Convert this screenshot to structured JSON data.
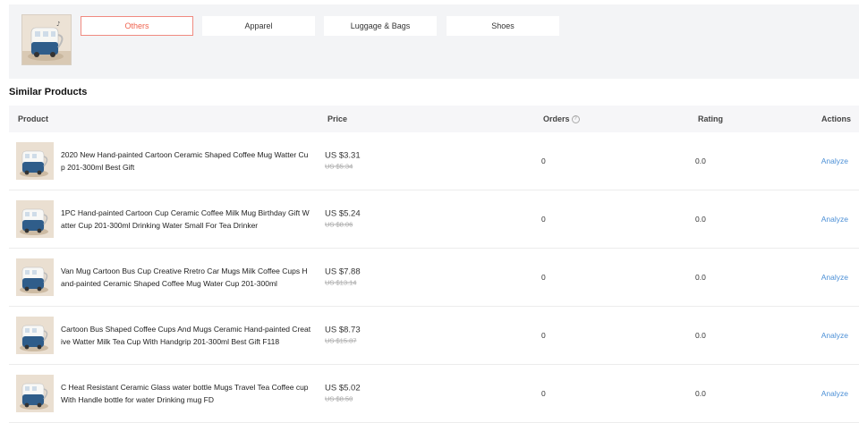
{
  "tabs": [
    "Others",
    "Apparel",
    "Luggage & Bags",
    "Shoes"
  ],
  "active_tab": 0,
  "section_title": "Similar Products",
  "table": {
    "headers": {
      "product": "Product",
      "price": "Price",
      "orders": "Orders",
      "rating": "Rating",
      "actions": "Actions"
    },
    "rows": [
      {
        "title": "2020 New Hand-painted Cartoon Ceramic Shaped Coffee Mug Watter Cup 201-300ml Best Gift",
        "price": "US $3.31",
        "original_price": "US $5.34",
        "orders": "0",
        "rating": "0.0",
        "action": "Analyze"
      },
      {
        "title": "1PC Hand-painted Cartoon Cup Ceramic Coffee Milk Mug Birthday Gift Watter Cup 201-300ml Drinking Water Small For Tea Drinker",
        "price": "US $5.24",
        "original_price": "US $8.06",
        "orders": "0",
        "rating": "0.0",
        "action": "Analyze"
      },
      {
        "title": "Van Mug Cartoon Bus Cup Creative Rretro Car Mugs Milk Coffee Cups Hand-painted Ceramic Shaped Coffee Mug Water Cup 201-300ml",
        "price": "US $7.88",
        "original_price": "US $13.14",
        "orders": "0",
        "rating": "0.0",
        "action": "Analyze"
      },
      {
        "title": "Cartoon Bus Shaped Coffee Cups And Mugs Ceramic Hand-painted Creative Watter Milk Tea Cup With Handgrip 201-300ml Best Gift F118",
        "price": "US $8.73",
        "original_price": "US $15.87",
        "orders": "0",
        "rating": "0.0",
        "action": "Analyze"
      },
      {
        "title": "C Heat Resistant Ceramic Glass water bottle Mugs Travel Tea Coffee cup With Handle bottle for water Drinking mug FD",
        "price": "US $5.02",
        "original_price": "US $8.50",
        "orders": "0",
        "rating": "0.0",
        "action": "Analyze"
      }
    ]
  },
  "colors": {
    "accent": "#f0634f",
    "link": "#4b8fd6",
    "panel_bg": "#f3f4f6"
  },
  "icons": {
    "orders_info": "question-circle-icon"
  }
}
